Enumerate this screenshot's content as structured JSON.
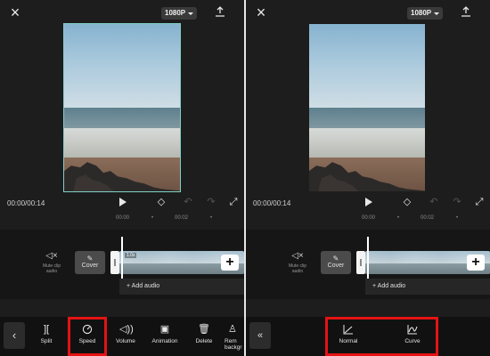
{
  "left": {
    "close_icon": "×",
    "resolution": "1080P",
    "upload_icon": "upload-icon",
    "time_display": "00:00/00:14",
    "ruler": [
      "00:00",
      "00:02"
    ],
    "mute_label": "Mute clip audio",
    "cover_label": "Cover",
    "speed_tag": "1.0x",
    "add_audio": "+ Add audio",
    "tools": [
      "Split",
      "Speed",
      "Volume",
      "Animation",
      "Delete",
      "Rem backgr"
    ]
  },
  "right": {
    "close_icon": "×",
    "resolution": "1080P",
    "upload_icon": "upload-icon",
    "time_display": "00:00/00:14",
    "ruler": [
      "00:00",
      "00:02"
    ],
    "mute_label": "Mute clip audio",
    "cover_label": "Cover",
    "add_audio": "+ Add audio",
    "speed_options": [
      "Normal",
      "Curve"
    ]
  },
  "colors": {
    "background": "#1d1d1d",
    "highlight": "#e31313",
    "selection_outline": "#7fd0c7"
  }
}
